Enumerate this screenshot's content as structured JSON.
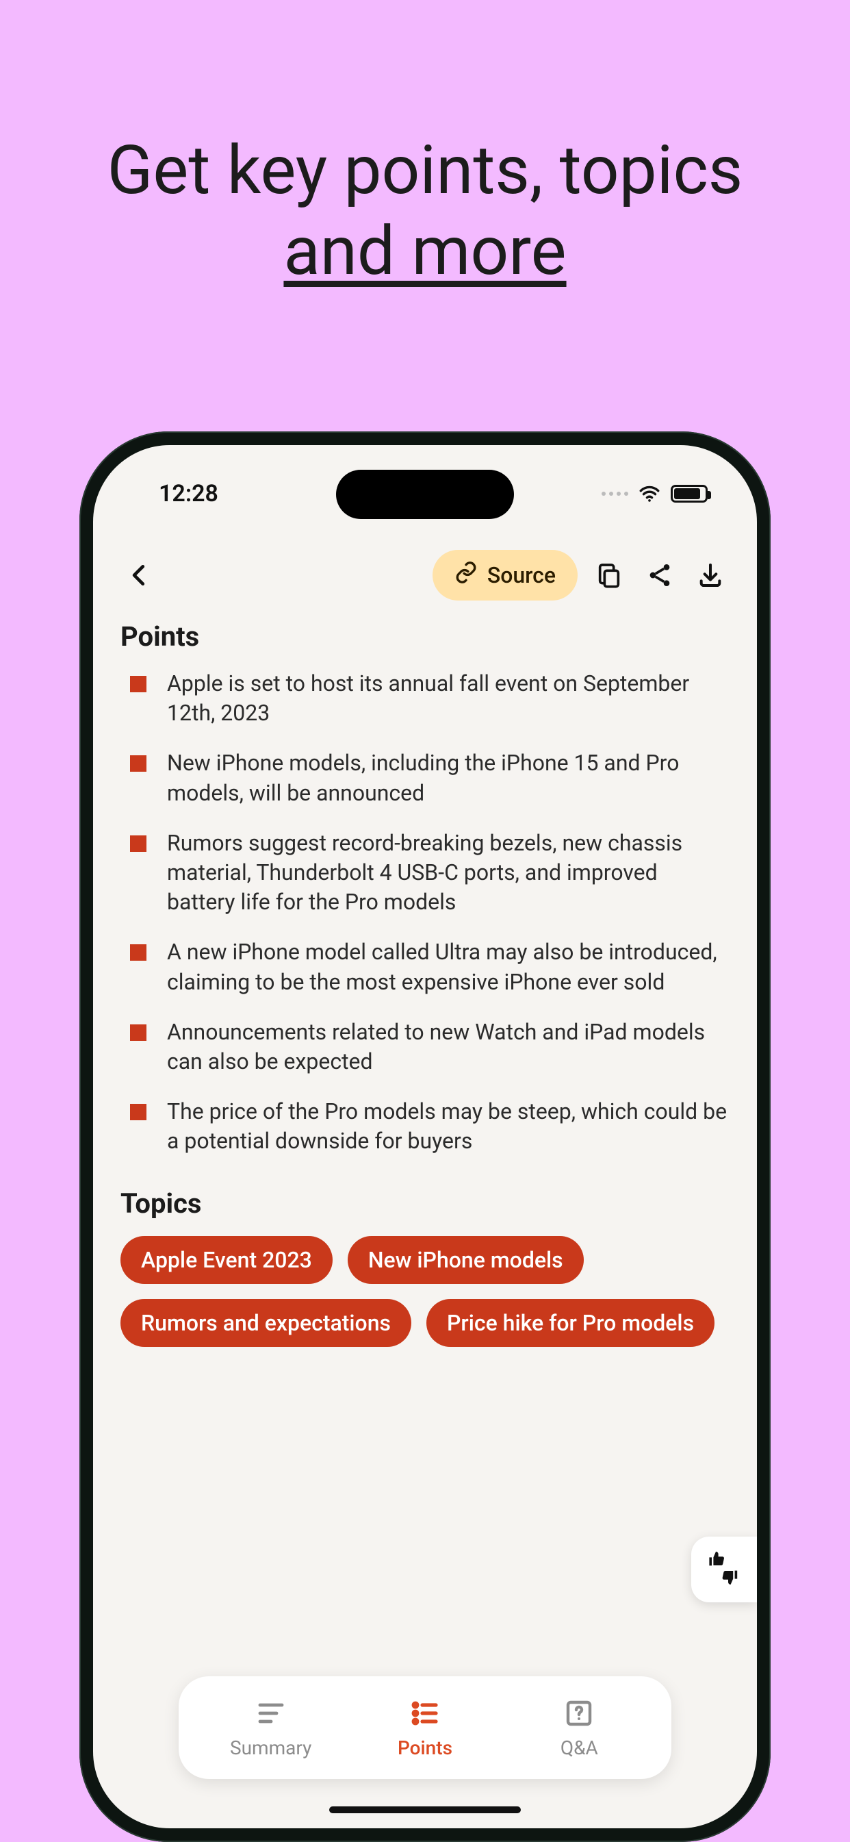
{
  "promo": {
    "line1": "Get key points, topics",
    "line2": "and more"
  },
  "status": {
    "time": "12:28"
  },
  "topbar": {
    "source_label": "Source"
  },
  "sections": {
    "points_title": "Points",
    "topics_title": "Topics"
  },
  "points": [
    "Apple is set to host its annual fall event on September 12th, 2023",
    "New iPhone models, including the iPhone 15 and Pro models, will be announced",
    "Rumors suggest record-breaking bezels, new chassis material, Thunderbolt 4 USB-C ports, and improved battery life for the Pro models",
    "A new iPhone model called Ultra may also be introduced, claiming to be the most expensive iPhone ever sold",
    "Announcements related to new Watch and iPad models can also be expected",
    "The price of the Pro models may be steep, which could be a potential downside for buyers"
  ],
  "topics": [
    "Apple Event 2023",
    "New iPhone models",
    "Rumors and expectations",
    "Price hike for Pro models"
  ],
  "nav": {
    "summary": "Summary",
    "points": "Points",
    "qa": "Q&A"
  },
  "colors": {
    "accent": "#c9391b",
    "pill": "#ffe2a8",
    "bg": "#f3baff"
  }
}
